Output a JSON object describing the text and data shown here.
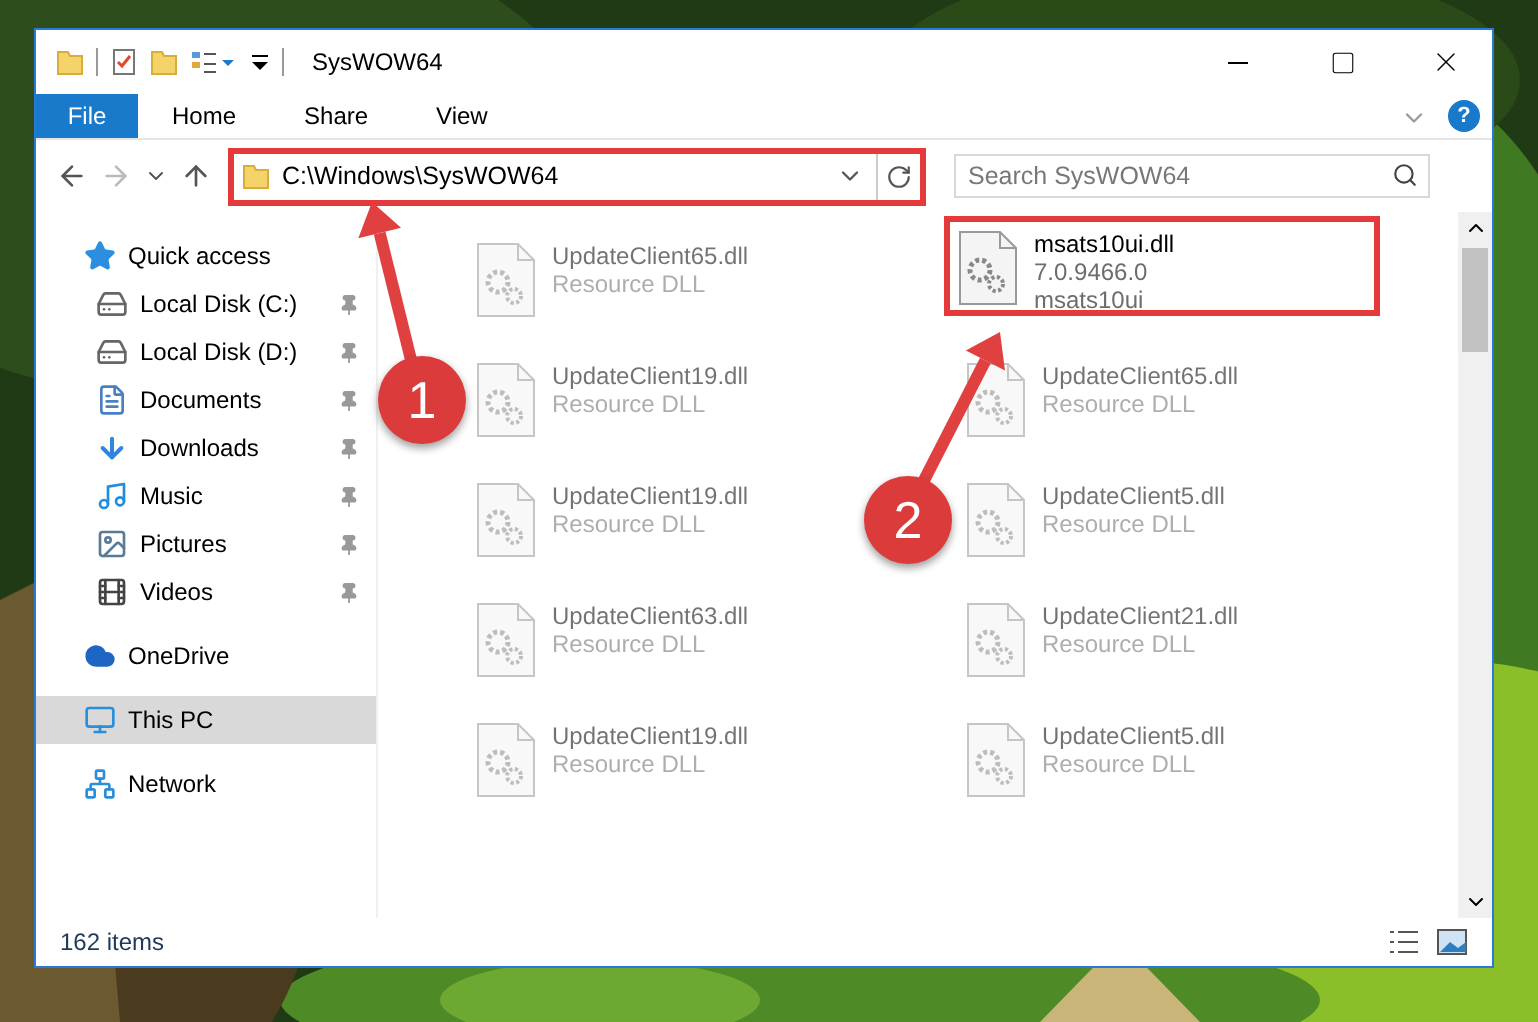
{
  "window": {
    "title": "SysWOW64"
  },
  "ribbon": {
    "tabs": [
      {
        "label": "File",
        "selected": true
      },
      {
        "label": "Home",
        "selected": false
      },
      {
        "label": "Share",
        "selected": false
      },
      {
        "label": "View",
        "selected": false
      }
    ],
    "help": "?"
  },
  "address": {
    "path": "C:\\Windows\\SysWOW64",
    "highlighted": true
  },
  "search": {
    "placeholder": "Search SysWOW64"
  },
  "sidebar": {
    "items": [
      {
        "label": "Quick access",
        "kind": "quick",
        "selected": false,
        "children": [
          {
            "label": "Local Disk (C:)",
            "kind": "drive",
            "pinned": true
          },
          {
            "label": "Local Disk (D:)",
            "kind": "drive",
            "pinned": true
          },
          {
            "label": "Documents",
            "kind": "documents",
            "pinned": true
          },
          {
            "label": "Downloads",
            "kind": "downloads",
            "pinned": true
          },
          {
            "label": "Music",
            "kind": "music",
            "pinned": true
          },
          {
            "label": "Pictures",
            "kind": "pictures",
            "pinned": true
          },
          {
            "label": "Videos",
            "kind": "videos",
            "pinned": true
          }
        ]
      },
      {
        "label": "OneDrive",
        "kind": "cloud",
        "selected": false
      },
      {
        "label": "This PC",
        "kind": "pc",
        "selected": true
      },
      {
        "label": "Network",
        "kind": "network",
        "selected": false
      }
    ]
  },
  "files": [
    {
      "name": "UpdateClient65.dll",
      "lines": [
        "Resource DLL"
      ],
      "dimmed": true,
      "highlighted": false
    },
    {
      "name": "msats10ui.dll",
      "lines": [
        "7.0.9466.0",
        "msats10ui"
      ],
      "dimmed": false,
      "highlighted": true
    },
    {
      "name": "UpdateClient19.dll",
      "lines": [
        "Resource DLL"
      ],
      "dimmed": true,
      "highlighted": false
    },
    {
      "name": "UpdateClient65.dll",
      "lines": [
        "Resource DLL"
      ],
      "dimmed": true,
      "highlighted": false
    },
    {
      "name": "UpdateClient19.dll",
      "lines": [
        "Resource DLL"
      ],
      "dimmed": true,
      "highlighted": false
    },
    {
      "name": "UpdateClient5.dll",
      "lines": [
        "Resource DLL"
      ],
      "dimmed": true,
      "highlighted": false
    },
    {
      "name": "UpdateClient63.dll",
      "lines": [
        "Resource DLL"
      ],
      "dimmed": true,
      "highlighted": false
    },
    {
      "name": "UpdateClient21.dll",
      "lines": [
        "Resource DLL"
      ],
      "dimmed": true,
      "highlighted": false
    },
    {
      "name": "UpdateClient19.dll",
      "lines": [
        "Resource DLL"
      ],
      "dimmed": true,
      "highlighted": false
    },
    {
      "name": "UpdateClient5.dll",
      "lines": [
        "Resource DLL"
      ],
      "dimmed": true,
      "highlighted": false
    }
  ],
  "status_bar": {
    "count": "162 items"
  },
  "callouts": [
    {
      "label": "1"
    },
    {
      "label": "2"
    }
  ]
}
